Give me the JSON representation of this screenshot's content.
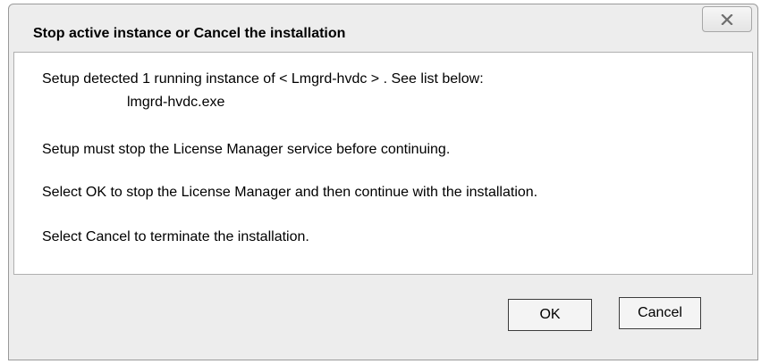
{
  "dialog": {
    "title": "Stop active instance or Cancel the installation",
    "close_icon": "close-icon",
    "message": {
      "line1": "Setup detected 1 running instance of < Lmgrd-hvdc > . See list below:",
      "process_name": "lmgrd-hvdc.exe",
      "line2": "Setup must stop the License Manager service before continuing.",
      "line3": "Select OK to stop the License Manager and then continue with the installation.",
      "line4": "Select Cancel to terminate the installation."
    },
    "buttons": {
      "ok_label": "OK",
      "cancel_label": "Cancel"
    }
  }
}
